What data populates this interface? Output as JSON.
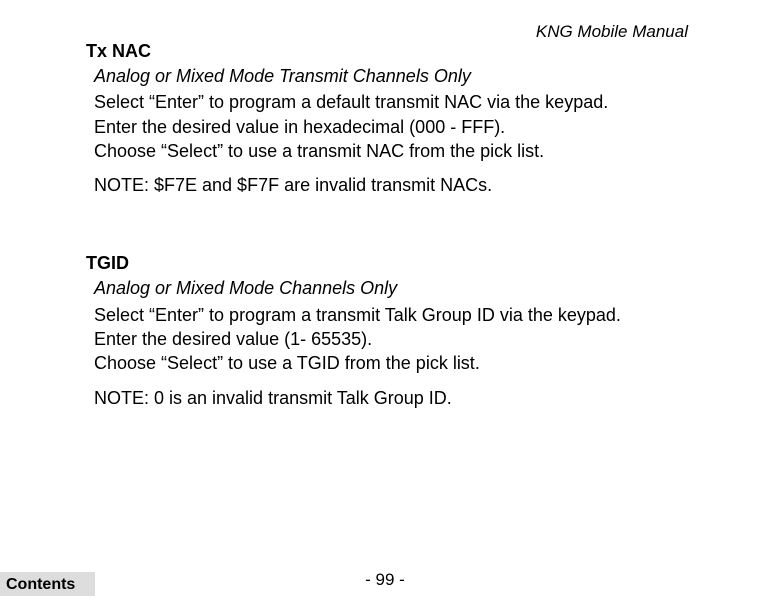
{
  "header": {
    "title": "KNG Mobile Manual"
  },
  "sections": [
    {
      "title": "Tx NAC",
      "subtitle": "Analog or Mixed Mode Transmit Channels Only",
      "lines": [
        "Select “Enter” to program a default transmit NAC via the keypad.",
        "Enter the desired value in hexadecimal (000 - FFF).",
        "Choose “Select” to use a transmit NAC from the pick list."
      ],
      "note": "NOTE: $F7E and $F7F are invalid transmit NACs."
    },
    {
      "title": "TGID",
      "subtitle": "Analog or Mixed Mode Channels Only",
      "lines": [
        "Select “Enter” to program a transmit Talk Group ID via the keypad.",
        "Enter the desired value (1- 65535).",
        "Choose “Select” to use a TGID from the pick list."
      ],
      "note": "NOTE: 0 is an invalid transmit Talk Group ID."
    }
  ],
  "footer": {
    "page": "- 99 -",
    "contents": "Contents"
  }
}
